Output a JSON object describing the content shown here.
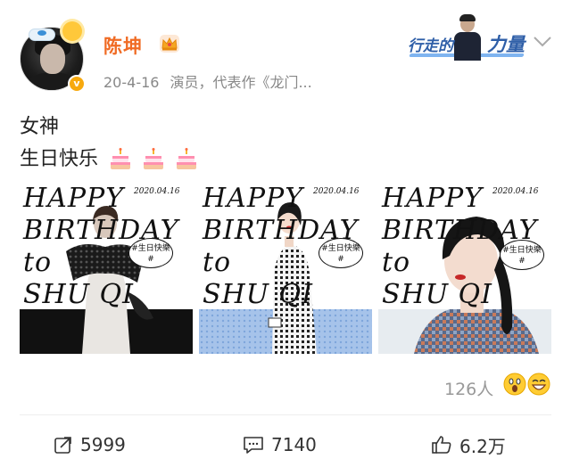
{
  "post": {
    "author": {
      "name": "陈坤",
      "avatar_icon": "avatar-photo",
      "verified_icon": "verified-v-icon",
      "crown_icon": "crown-icon",
      "verified_mark": "v"
    },
    "meta": {
      "date": "20-4-16",
      "description": "演员，代表作《龙门..."
    },
    "topic_banner": {
      "text_small": "行走的",
      "text_big": "力量"
    },
    "text": {
      "line1": "女神",
      "line2": "生日快乐"
    },
    "images": [
      {
        "title_lines": [
          "HAPPY",
          "BIRTHDAY",
          "to",
          "SHU QI"
        ],
        "date": "2020.04.16",
        "tag": "#生日快樂#",
        "style": "black-white-photo"
      },
      {
        "title_lines": [
          "HAPPY",
          "BIRTHDAY",
          "to",
          "SHU QI"
        ],
        "date": "2020.04.16",
        "tag": "#生日快樂#",
        "style": "illustration-blue-dots"
      },
      {
        "title_lines": [
          "HAPPY",
          "BIRTHDAY",
          "to",
          "SHU QI"
        ],
        "date": "2020.04.16",
        "tag": "#生日快樂#",
        "style": "color-portrait"
      }
    ],
    "reactions": {
      "count": "126人",
      "emoji": [
        "surprised-face-icon",
        "grinning-face-icon"
      ]
    },
    "actions": {
      "share_count": "5999",
      "comment_count": "7140",
      "like_count": "6.2万"
    }
  },
  "colors": {
    "username": "#f06b24",
    "meta_text": "#888888",
    "topic_blue": "#2f5fa8",
    "blue_dot_bg": "#a6c3ea"
  }
}
